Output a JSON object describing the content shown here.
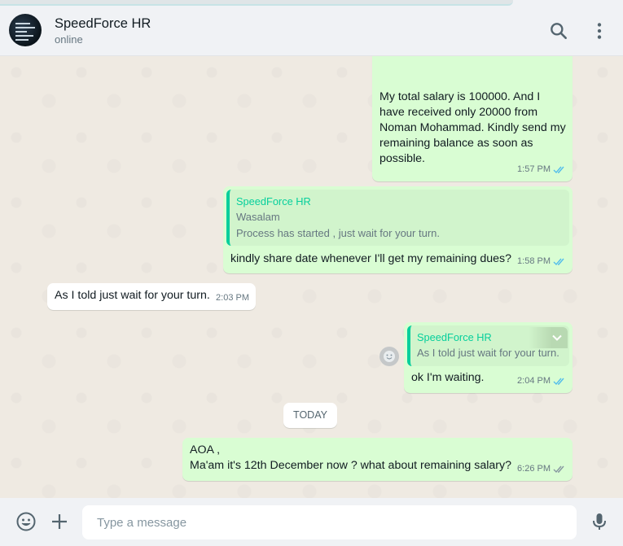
{
  "header": {
    "contact_name": "SpeedForce HR",
    "contact_status": "online",
    "icons": [
      "search-icon",
      "menu-dots-icon"
    ]
  },
  "messages": [
    {
      "direction": "outgoing",
      "lines": [
        "My total salary is 100000. And I",
        "have received only 20000 from",
        "Noman Mohammad. Kindly send my",
        "remaining balance as soon as",
        "possible."
      ],
      "time": "1:57 PM",
      "status": "read"
    },
    {
      "direction": "outgoing",
      "quote": {
        "author": "SpeedForce HR",
        "lines": [
          "Wasalam",
          "Process has started , just wait for your turn."
        ]
      },
      "text": "kindly share date whenever I'll get my remaining dues?",
      "time": "1:58 PM",
      "status": "read"
    },
    {
      "direction": "incoming",
      "text": "As I told just wait for your turn.",
      "time": "2:03 PM"
    },
    {
      "direction": "outgoing",
      "quote": {
        "author": "SpeedForce HR",
        "lines": [
          "As I told just wait for your turn."
        ]
      },
      "text": "ok I'm waiting.",
      "time": "2:04 PM",
      "status": "read"
    },
    {
      "direction": "outgoing",
      "lines": [
        "AOA ,",
        "Ma'am it's 12th December now ? what about remaining salary?"
      ],
      "time": "6:26 PM",
      "status": "delivered"
    }
  ],
  "day_separator": "TODAY",
  "footer": {
    "placeholder": "Type a message",
    "icons": [
      "emoji-icon",
      "attach-plus-icon",
      "microphone-icon"
    ]
  },
  "colors": {
    "outgoing_bubble": "#d9fdd3",
    "incoming_bubble": "#ffffff",
    "accent": "#06cf9c",
    "read_ticks": "#53bdeb",
    "chat_background": "#efeae2"
  }
}
